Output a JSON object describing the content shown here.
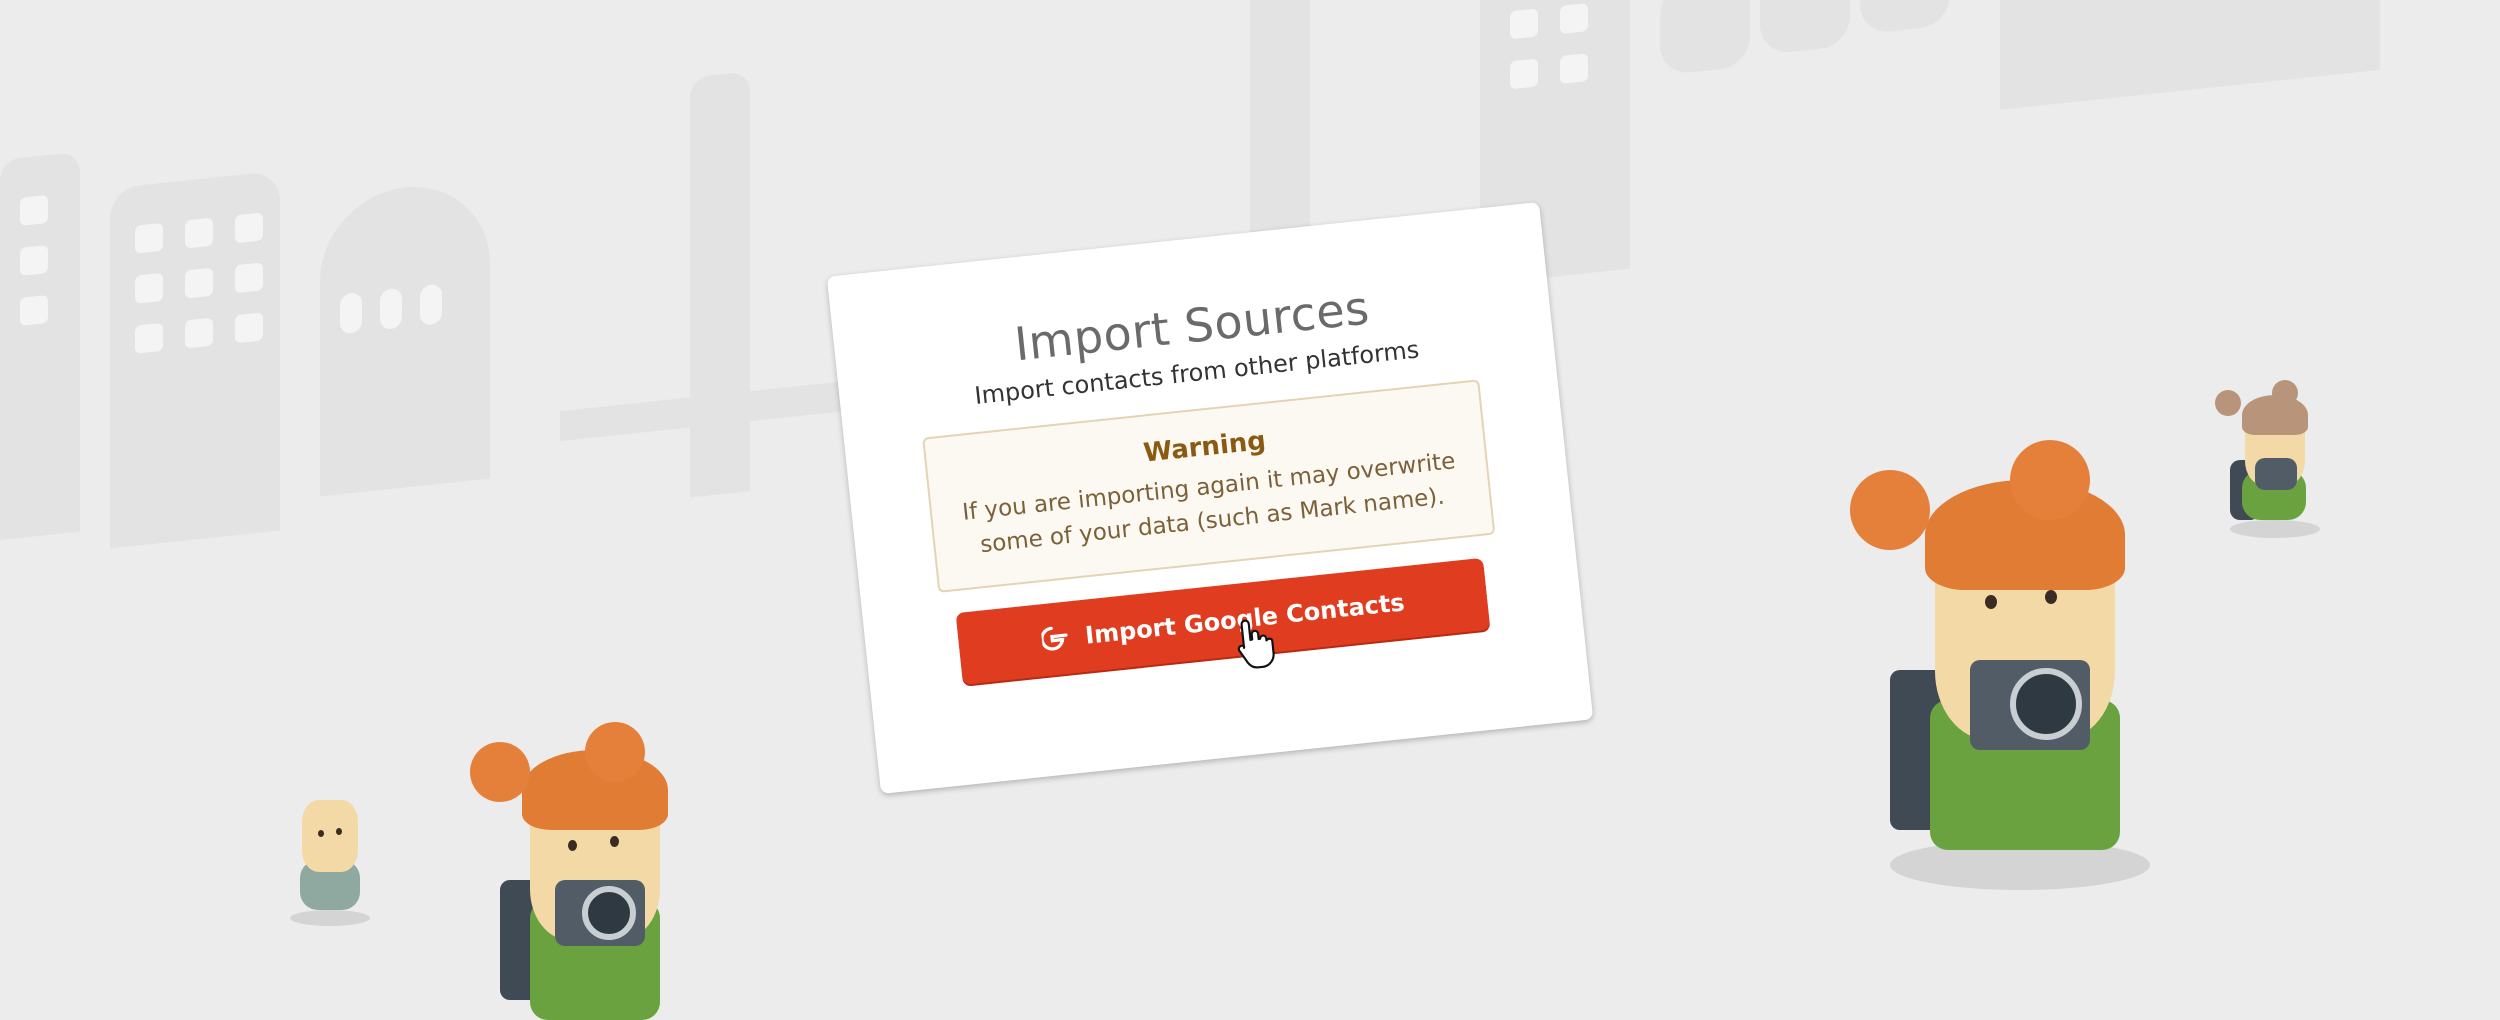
{
  "dialog": {
    "title": "Import Sources",
    "subtitle": "Import contacts from other platforms",
    "warning": {
      "title": "Warning",
      "text": "If you are importing again it may overwrite some of your data (such as Mark name)."
    },
    "import_button": {
      "label": "Import Google Contacts",
      "icon": "google-icon"
    }
  },
  "colors": {
    "button": "#e03c20",
    "warning_border": "#e4d4b6",
    "warning_bg": "#fcf8f2",
    "background": "#ececec"
  }
}
